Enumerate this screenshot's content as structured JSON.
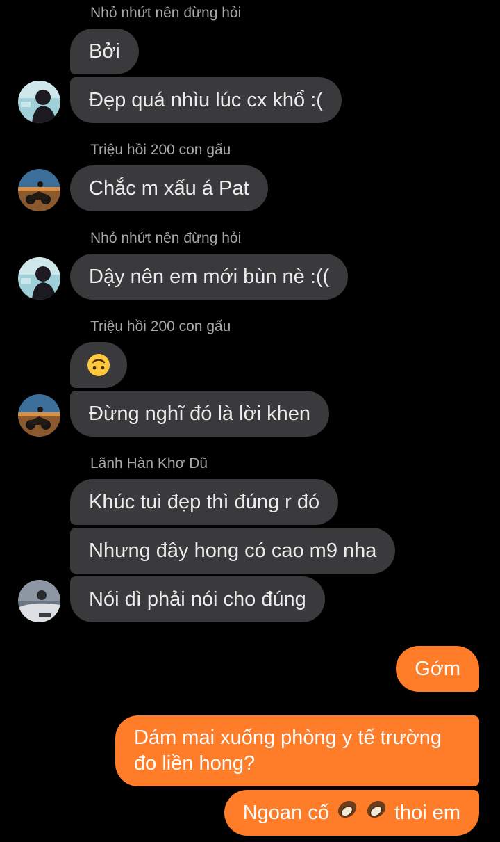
{
  "colors": {
    "background": "#000000",
    "incoming_bubble": "#3a3a3c",
    "outgoing_bubble": "#ff7d29",
    "sender_name": "#a8a8a8"
  },
  "messages": {
    "sender_1": "Nhỏ nhứt nên đừng hỏi",
    "m1": "Bởi",
    "m2": "Đẹp quá nhìu lúc cx khổ :(",
    "sender_2": "Triệu hồi 200 con gấu",
    "m3": "Chắc m xấu á Pat",
    "sender_3": "Nhỏ nhứt nên đừng hỏi",
    "m4": "Dậy nên em mới bùn nè :((",
    "sender_4": "Triệu hồi 200 con gấu",
    "m5_emoji": "upside-down-face-emoji",
    "m6": "Đừng nghĩ đó là lời khen",
    "sender_5": "Lãnh Hàn Khơ Dũ",
    "m7": "Khúc tui đẹp thì đúng r đó",
    "m8": "Nhưng đây hong có cao m9 nha",
    "m9": "Nói dì phải nói cho đúng",
    "out1": "Gớm",
    "out2_line1": "Dám mai xuống phòng y tế trường",
    "out2_line2": "đo liền hong?",
    "out3_prefix": "Ngoan cố",
    "out3_suffix": "thoi em",
    "out3_icons": [
      "coconut-icon",
      "coconut-icon"
    ]
  },
  "avatars": [
    "avatar-nho-nhut",
    "avatar-trieu-hoi",
    "avatar-nho-nhut",
    "avatar-trieu-hoi",
    "avatar-lanh-han"
  ]
}
